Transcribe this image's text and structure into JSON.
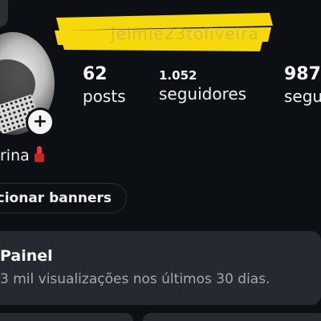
{
  "header": {
    "username": "jelmie23toliveira"
  },
  "stats": {
    "posts_count": "62",
    "posts_label": "posts",
    "followers_count": "1.052",
    "followers_label": "seguidores",
    "following_count": "987",
    "following_label": "seguindo"
  },
  "profile": {
    "name_visible": "rina",
    "name_emoji_icon": "lipstick-icon",
    "add_story_symbol": "+"
  },
  "actions": {
    "banners_label": "Adicionar banners"
  },
  "panel": {
    "title": "Painel",
    "subtitle": "3 mil visualizações nos últimos 30 dias."
  },
  "colors": {
    "background": "#0c1014",
    "card": "#262a30",
    "redaction_highlight": "#f5d90a",
    "secondary_text": "#a8a8a8"
  }
}
